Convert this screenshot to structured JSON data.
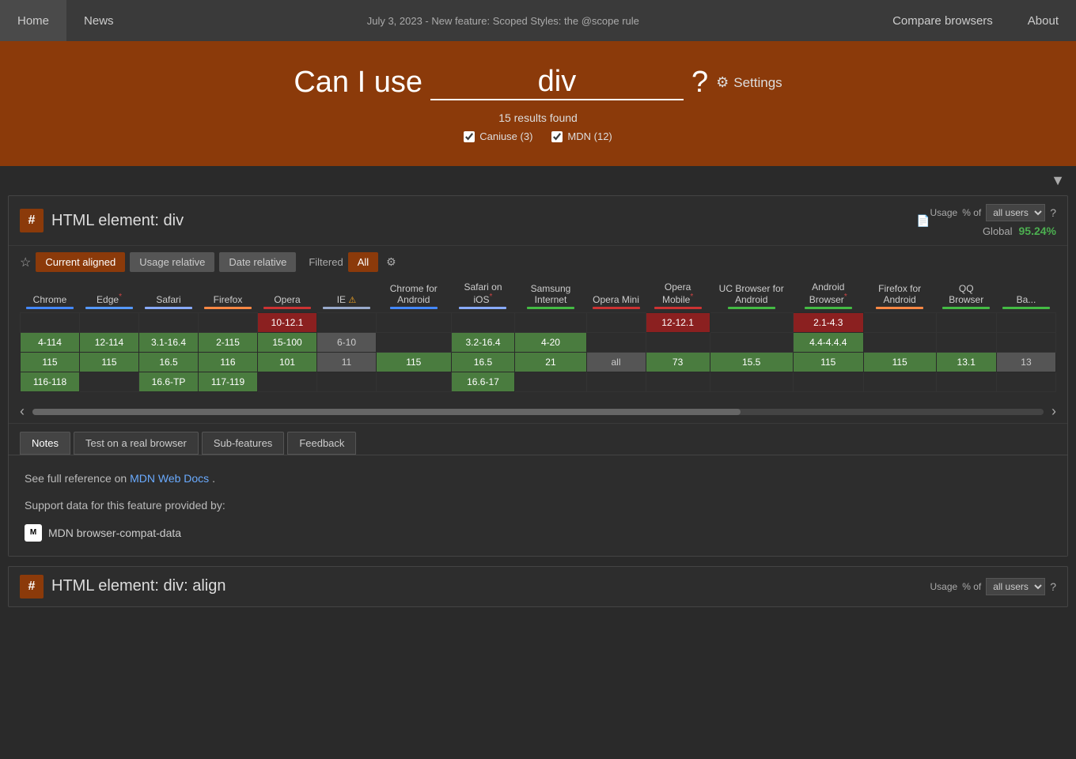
{
  "nav": {
    "home": "Home",
    "news": "News",
    "compare": "Compare browsers",
    "about": "About",
    "announcement": "July 3, 2023 - New feature: Scoped Styles: the @scope rule"
  },
  "hero": {
    "label": "Can I use",
    "search_value": "div",
    "question_mark": "?",
    "settings_label": "Settings",
    "results_text": "15 results found",
    "filter_caniuse": "Caniuse (3)",
    "filter_mdn": "MDN (12)"
  },
  "filter_icon": "▼",
  "feature1": {
    "hash": "#",
    "title": "HTML element: div",
    "doc_icon": "📄",
    "usage_label": "Usage",
    "usage_of": "% of",
    "usage_select": "all users",
    "usage_help": "?",
    "global_label": "Global",
    "global_pct": "95.24%",
    "tabs": [
      "Notes",
      "Test on a real browser",
      "Sub-features",
      "Feedback"
    ],
    "active_tab": "Notes",
    "controls": {
      "current_aligned": "Current aligned",
      "usage_relative": "Usage relative",
      "date_relative": "Date relative",
      "filtered": "Filtered",
      "all": "All"
    },
    "browsers": [
      {
        "name": "Chrome",
        "bar_class": "chrome-bar",
        "asterisk": false,
        "warn": false
      },
      {
        "name": "Edge",
        "bar_class": "edge-bar",
        "asterisk": true,
        "warn": false
      },
      {
        "name": "Safari",
        "bar_class": "safari-bar",
        "asterisk": false,
        "warn": false
      },
      {
        "name": "Firefox",
        "bar_class": "firefox-bar",
        "asterisk": false,
        "warn": false
      },
      {
        "name": "Opera",
        "bar_class": "opera-bar",
        "asterisk": false,
        "warn": false
      },
      {
        "name": "IE",
        "bar_class": "ie-bar",
        "asterisk": false,
        "warn": true
      },
      {
        "name": "Chrome for Android",
        "bar_class": "android-bar",
        "asterisk": false,
        "warn": false
      },
      {
        "name": "Safari on iOS",
        "bar_class": "safari-bar",
        "asterisk": true,
        "warn": false
      },
      {
        "name": "Samsung Internet",
        "bar_class": "samsung-bar",
        "asterisk": false,
        "warn": false
      },
      {
        "name": "Opera Mini",
        "bar_class": "opera-bar",
        "asterisk": false,
        "warn": false
      },
      {
        "name": "Opera Mobile",
        "bar_class": "opera-bar",
        "asterisk": true,
        "warn": false
      },
      {
        "name": "UC Browser for Android",
        "bar_class": "android-bar",
        "asterisk": false,
        "warn": false
      },
      {
        "name": "Android Browser",
        "bar_class": "android-bar",
        "asterisk": true,
        "warn": false
      },
      {
        "name": "Firefox for Android",
        "bar_class": "firefox-bar",
        "asterisk": false,
        "warn": false
      },
      {
        "name": "QQ Browser",
        "bar_class": "android-bar",
        "asterisk": false,
        "warn": false
      },
      {
        "name": "Ba...",
        "bar_class": "android-bar",
        "asterisk": false,
        "warn": false
      }
    ],
    "rows": {
      "red": [
        {
          "chrome": "",
          "edge": "",
          "safari": "",
          "firefox": "",
          "opera": "10-12.1",
          "ie": "",
          "cfa": "",
          "sios": "",
          "si": "",
          "om": "",
          "omob": "12-12.1",
          "uca": "",
          "ab": "2.1-4.3",
          "ffa": "",
          "qq": "",
          "ba": ""
        },
        {
          "chrome": "4-114",
          "edge": "12-114",
          "safari": "3.1-16.4",
          "firefox": "2-115",
          "opera": "15-100",
          "ie": "6-10",
          "cfa": "",
          "sios": "3.2-16.4",
          "si": "4-20",
          "om": "",
          "omob": "",
          "uca": "",
          "ab": "4.4-4.4.4",
          "ffa": "",
          "qq": "",
          "ba": ""
        },
        {
          "chrome": "115",
          "edge": "115",
          "safari": "16.5",
          "firefox": "116",
          "opera": "101",
          "ie": "11",
          "cfa": "115",
          "sios": "16.5",
          "si": "21",
          "om": "all",
          "omob": "73",
          "uca": "15.5",
          "ab": "115",
          "ffa": "115",
          "qq": "13.1",
          "ba": "13"
        },
        {
          "chrome": "116-118",
          "edge": "",
          "safari": "16.6-TP",
          "firefox": "117-119",
          "opera": "",
          "ie": "",
          "cfa": "",
          "sios": "16.6-17",
          "si": "",
          "om": "",
          "omob": "",
          "uca": "",
          "ab": "",
          "ffa": "",
          "qq": "",
          "ba": ""
        }
      ]
    },
    "notes_content": {
      "mdn_text": "See full reference on",
      "mdn_link_text": "MDN Web Docs",
      "mdn_link": "#",
      "period": ".",
      "support_text": "Support data for this feature provided by:",
      "mdn_compat": "MDN browser-compat-data"
    }
  },
  "feature2": {
    "hash": "#",
    "title": "HTML element: div: align",
    "usage_label": "Usage",
    "usage_of": "% of",
    "usage_select": "all users",
    "usage_help": "?"
  }
}
